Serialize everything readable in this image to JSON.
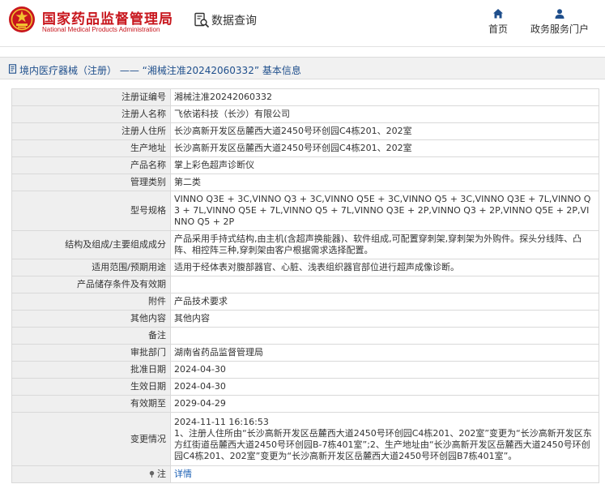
{
  "header": {
    "logo_cn": "国家药品监督管理局",
    "logo_en": "National Medical Products Administration",
    "search_title": "数据查询",
    "nav": [
      {
        "label": "首页",
        "icon": "home-icon"
      },
      {
        "label": "政务服务门户",
        "icon": "user-icon"
      }
    ]
  },
  "breadcrumb": {
    "text": "境内医疗器械（注册） —— “湘械注准20242060332” 基本信息"
  },
  "colors": {
    "brand_red": "#c8161d",
    "nav_blue": "#1f4f8c",
    "link_blue": "#1a5fb4"
  },
  "fields": [
    {
      "label": "注册证编号",
      "value": "湘械注准20242060332"
    },
    {
      "label": "注册人名称",
      "value": "飞依诺科技（长沙）有限公司"
    },
    {
      "label": "注册人住所",
      "value": "长沙高新开发区岳麓西大道2450号环创园C4栋201、202室"
    },
    {
      "label": "生产地址",
      "value": "长沙高新开发区岳麓西大道2450号环创园C4栋201、202室"
    },
    {
      "label": "产品名称",
      "value": "掌上彩色超声诊断仪"
    },
    {
      "label": "管理类别",
      "value": "第二类"
    },
    {
      "label": "型号规格",
      "value": "VINNO Q3E + 3C,VINNO Q3 + 3C,VINNO Q5E + 3C,VINNO Q5 + 3C,VINNO Q3E + 7L,VINNO Q3 + 7L,VINNO Q5E + 7L,VINNO Q5 + 7L,VINNO Q3E + 2P,VINNO Q3 + 2P,VINNO Q5E + 2P,VINNO Q5 + 2P"
    },
    {
      "label": "结构及组成/主要组成成分",
      "value": "产品采用手持式结构,由主机(含超声换能器)、软件组成,可配置穿刺架,穿刺架为外购件。探头分线阵、凸阵、相控阵三种,穿刺架由客户根据需求选择配置。"
    },
    {
      "label": "适用范围/预期用途",
      "value": "适用于经体表对腹部器官、心脏、浅表组织器官部位进行超声成像诊断。"
    },
    {
      "label": "产品储存条件及有效期",
      "value": ""
    },
    {
      "label": "附件",
      "value": "产品技术要求"
    },
    {
      "label": "其他内容",
      "value": "其他内容"
    },
    {
      "label": "备注",
      "value": ""
    },
    {
      "label": "审批部门",
      "value": "湖南省药品监督管理局"
    },
    {
      "label": "批准日期",
      "value": "2024-04-30"
    },
    {
      "label": "生效日期",
      "value": "2024-04-30"
    },
    {
      "label": "有效期至",
      "value": "2029-04-29"
    },
    {
      "label": "变更情况",
      "value": "2024-11-11 16:16:53\n1、注册人住所由“长沙高新开发区岳麓西大道2450号环创园C4栋201、202室”变更为“长沙高新开发区东方红街道岳麓西大道2450号环创园B-7栋401室”;2、生产地址由“长沙高新开发区岳麓西大道2450号环创园C4栋201、202室”变更为“长沙高新开发区岳麓西大道2450号环创园B7栋401室”。"
    }
  ],
  "note": {
    "label": "注",
    "link": "详情",
    "icon": "pin-icon"
  }
}
